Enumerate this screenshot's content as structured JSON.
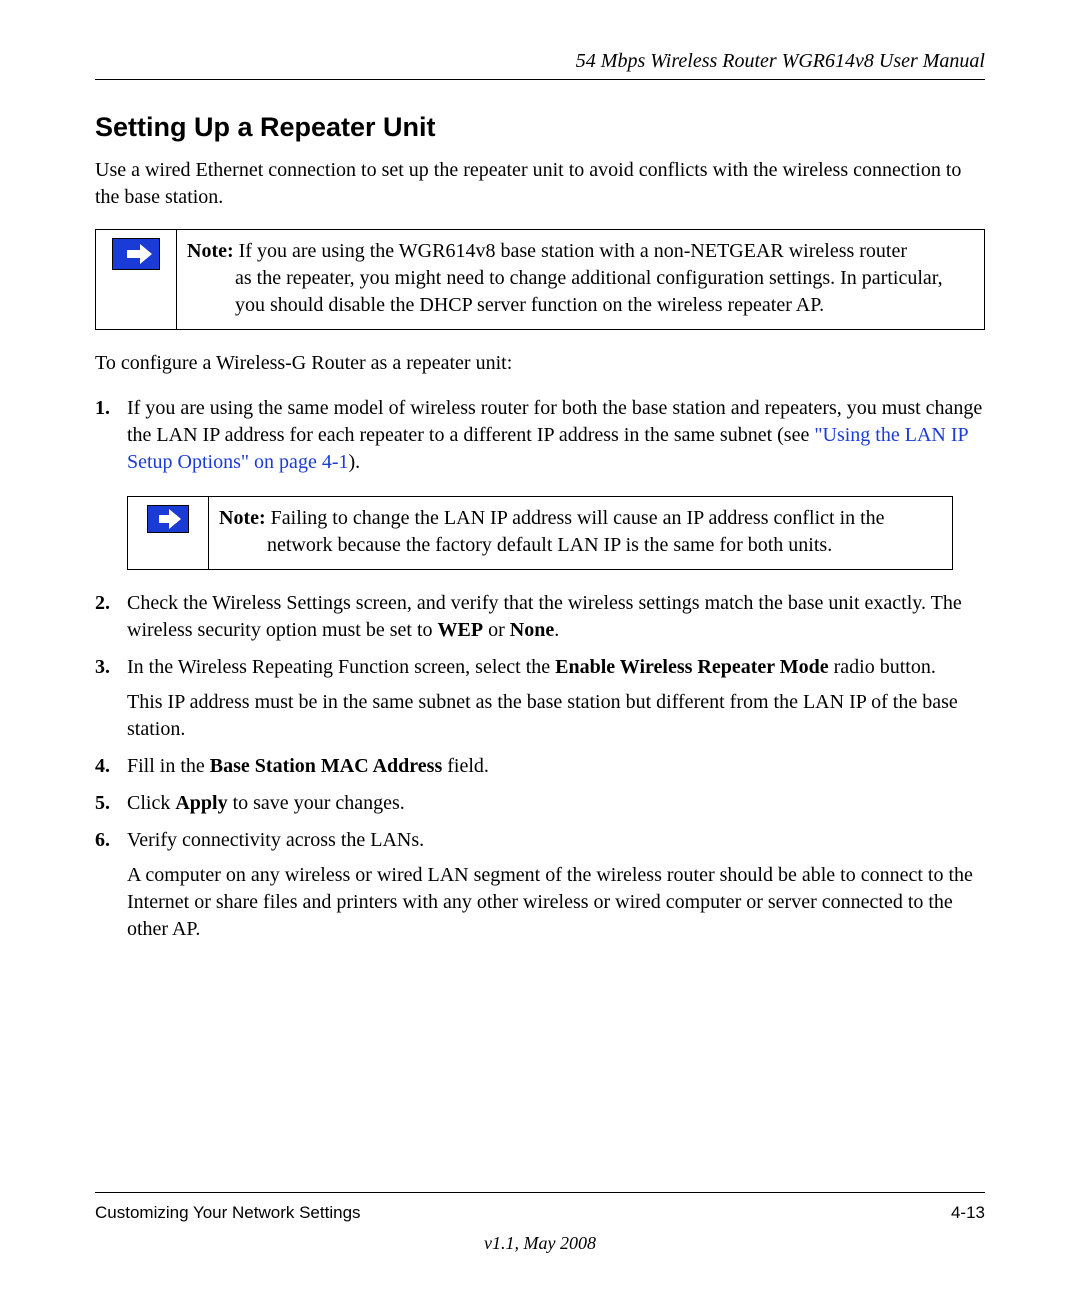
{
  "header": {
    "running_title": "54 Mbps Wireless Router WGR614v8 User Manual"
  },
  "section": {
    "title": "Setting Up a Repeater Unit",
    "intro": "Use a wired Ethernet connection to set up the repeater unit to avoid conflicts with the wireless connection to the base station."
  },
  "note1": {
    "label": "Note:",
    "lead": " If you are using the WGR614v8 base station with a non-NETGEAR wireless router ",
    "cont": "as the repeater, you might need to change additional configuration settings. In particular, you should disable the DHCP server function on the wireless repeater AP."
  },
  "lead_sentence": "To configure a Wireless-G Router as a repeater unit:",
  "steps": {
    "s1_a": "If you are using the same model of wireless router for both the base station and repeaters, you must change the LAN IP address for each repeater to a different IP address in the same subnet (see ",
    "s1_link": "\"Using the LAN IP Setup Options\" on page 4-1",
    "s1_b": ").",
    "s2_a": "Check the Wireless Settings screen, and verify that the wireless settings match the base unit exactly. The wireless security option must be set to ",
    "s2_wep": "WEP",
    "s2_or": " or ",
    "s2_none": "None",
    "s2_end": ".",
    "s3_a": "In the Wireless Repeating Function screen, select the ",
    "s3_bold": "Enable Wireless Repeater Mode",
    "s3_b": " radio button.",
    "s3_sub": "This IP address must be in the same subnet as the base station but different from the LAN IP of the base station.",
    "s4_a": "Fill in the ",
    "s4_bold": "Base Station MAC Address",
    "s4_b": " field.",
    "s5_a": "Click ",
    "s5_bold": "Apply",
    "s5_b": " to save your changes.",
    "s6_a": "Verify connectivity across the LANs.",
    "s6_sub": "A computer on any wireless or wired LAN segment of the wireless router should be able to connect to the Internet or share files and printers with any other wireless or wired computer or server connected to the other AP."
  },
  "note2": {
    "label": "Note:",
    "lead": " Failing to change the LAN IP address will cause an IP address conflict in the ",
    "cont": "network because the factory default LAN IP is the same for both units."
  },
  "footer": {
    "chapter": "Customizing Your Network Settings",
    "page": "4-13",
    "version": "v1.1, May 2008"
  }
}
